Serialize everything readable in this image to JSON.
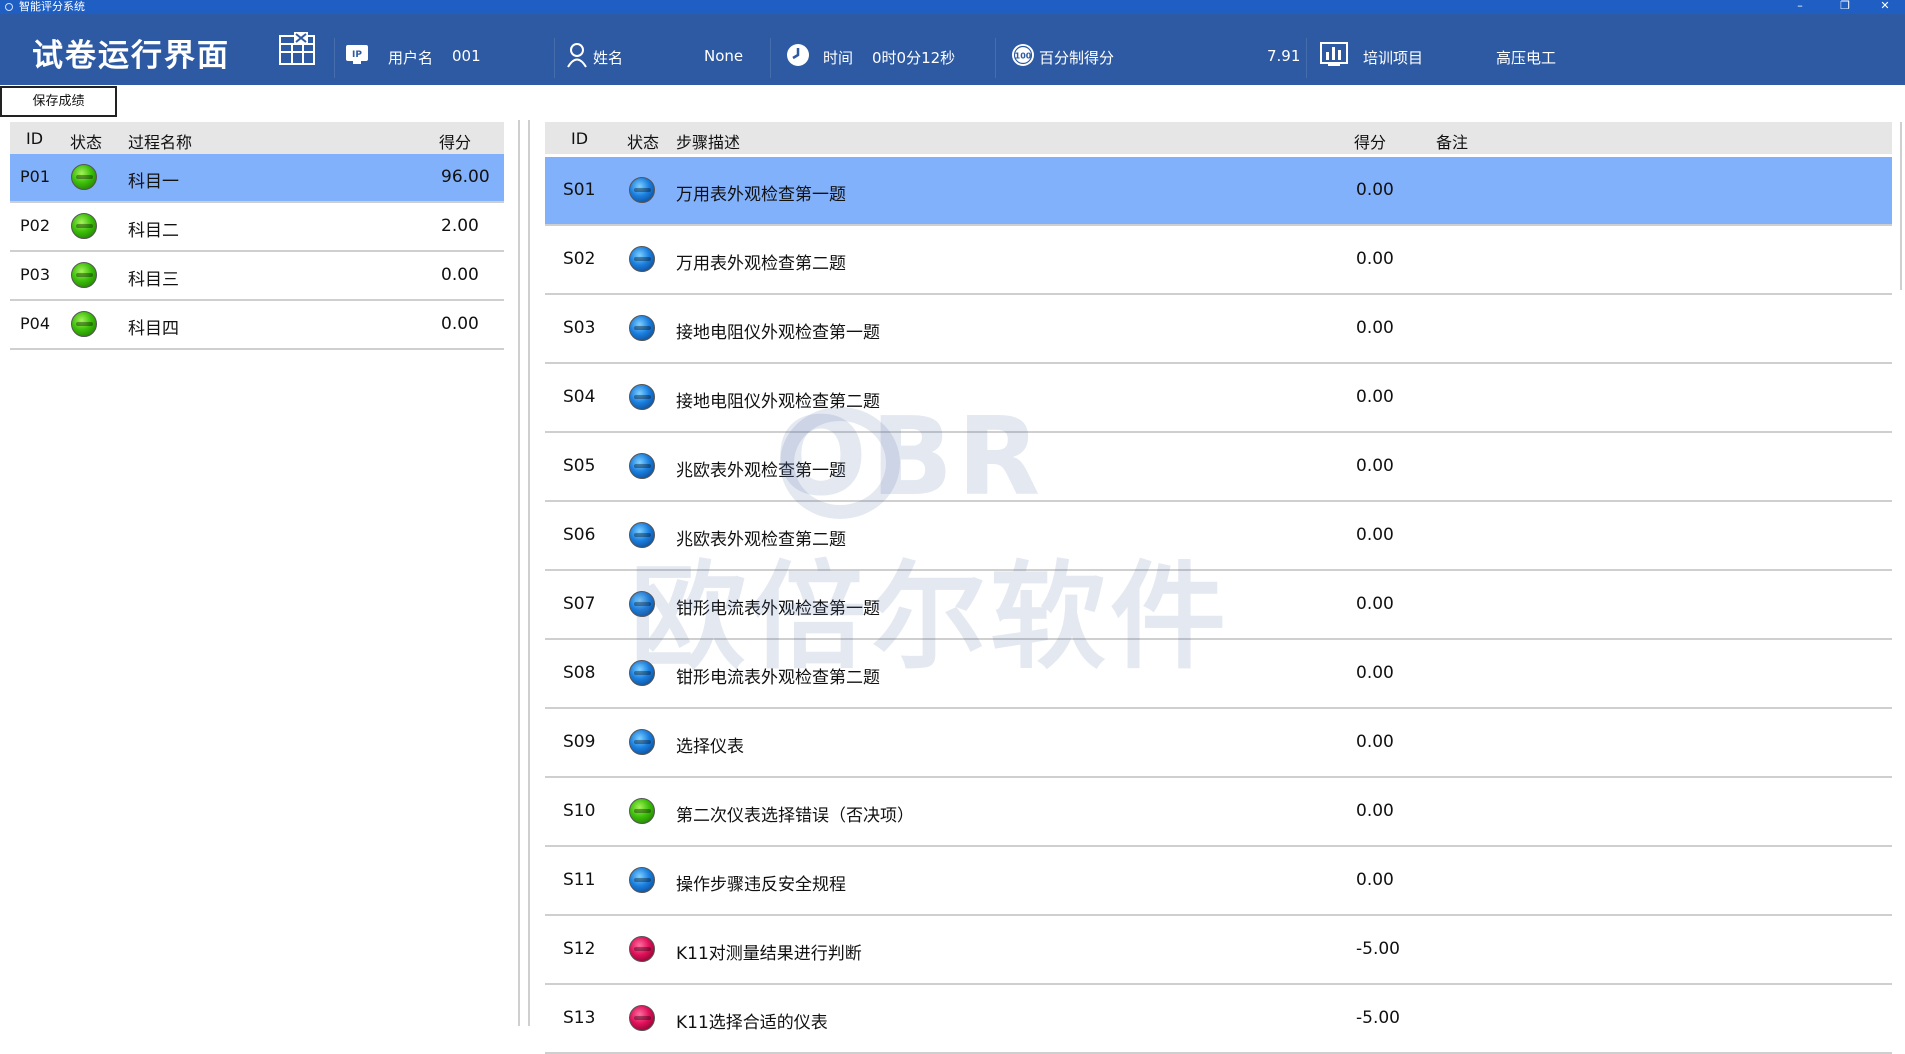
{
  "window": {
    "app_name": "智能评分系统",
    "min_label": "–",
    "max_label": "❐",
    "close_label": "✕"
  },
  "header": {
    "title": "试卷运行界面",
    "ip_icon_label": "IP",
    "username_label": "用户名",
    "username_value": "001",
    "name_label": "姓名",
    "name_value": "None",
    "time_label": "时间",
    "time_value": "0时0分12秒",
    "score_icon_label": "100",
    "score_label": "百分制得分",
    "score_value": "7.91",
    "project_label": "培训项目",
    "project_value": "高压电工"
  },
  "toolbar": {
    "save_label": "保存成绩"
  },
  "process_table": {
    "headers": {
      "id": "ID",
      "status": "状态",
      "name": "过程名称",
      "score": "得分"
    },
    "rows": [
      {
        "id": "P01",
        "status": "green",
        "name": "科目一",
        "score": "96.00"
      },
      {
        "id": "P02",
        "status": "green",
        "name": "科目二",
        "score": "2.00"
      },
      {
        "id": "P03",
        "status": "green",
        "name": "科目三",
        "score": "0.00"
      },
      {
        "id": "P04",
        "status": "green",
        "name": "科目四",
        "score": "0.00"
      }
    ]
  },
  "step_table": {
    "headers": {
      "id": "ID",
      "status": "状态",
      "desc": "步骤描述",
      "score": "得分",
      "note": "备注"
    },
    "rows": [
      {
        "id": "S01",
        "status": "blue",
        "desc": "万用表外观检查第一题",
        "score": "0.00",
        "note": ""
      },
      {
        "id": "S02",
        "status": "blue",
        "desc": "万用表外观检查第二题",
        "score": "0.00",
        "note": ""
      },
      {
        "id": "S03",
        "status": "blue",
        "desc": "接地电阻仪外观检查第一题",
        "score": "0.00",
        "note": ""
      },
      {
        "id": "S04",
        "status": "blue",
        "desc": "接地电阻仪外观检查第二题",
        "score": "0.00",
        "note": ""
      },
      {
        "id": "S05",
        "status": "blue",
        "desc": "兆欧表外观检查第一题",
        "score": "0.00",
        "note": ""
      },
      {
        "id": "S06",
        "status": "blue",
        "desc": "兆欧表外观检查第二题",
        "score": "0.00",
        "note": ""
      },
      {
        "id": "S07",
        "status": "blue",
        "desc": "钳形电流表外观检查第一题",
        "score": "0.00",
        "note": ""
      },
      {
        "id": "S08",
        "status": "blue",
        "desc": "钳形电流表外观检查第二题",
        "score": "0.00",
        "note": ""
      },
      {
        "id": "S09",
        "status": "blue",
        "desc": "选择仪表",
        "score": "0.00",
        "note": ""
      },
      {
        "id": "S10",
        "status": "green",
        "desc": "第二次仪表选择错误（否决项）",
        "score": "0.00",
        "note": ""
      },
      {
        "id": "S11",
        "status": "blue",
        "desc": "操作步骤违反安全规程",
        "score": "0.00",
        "note": ""
      },
      {
        "id": "S12",
        "status": "red",
        "desc": "K11对测量结果进行判断",
        "score": "-5.00",
        "note": ""
      },
      {
        "id": "S13",
        "status": "red",
        "desc": "K11选择合适的仪表",
        "score": "-5.00",
        "note": ""
      }
    ]
  },
  "watermark": {
    "logo": "OBR",
    "text": "欧倍尔软件"
  },
  "colors": {
    "header_bg": "#2d5aa2",
    "selected_row": "#82b1fb",
    "table_header": "#e6e6e6"
  }
}
